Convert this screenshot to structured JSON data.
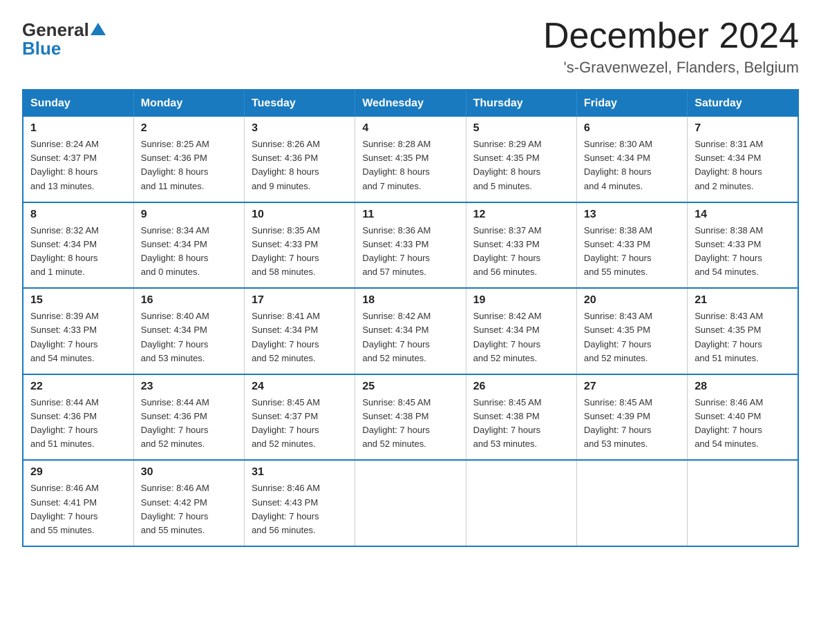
{
  "logo": {
    "part1": "General",
    "part2": "Blue"
  },
  "title": "December 2024",
  "subtitle": "'s-Gravenwezel, Flanders, Belgium",
  "calendar": {
    "headers": [
      "Sunday",
      "Monday",
      "Tuesday",
      "Wednesday",
      "Thursday",
      "Friday",
      "Saturday"
    ],
    "weeks": [
      [
        {
          "day": "1",
          "info": "Sunrise: 8:24 AM\nSunset: 4:37 PM\nDaylight: 8 hours\nand 13 minutes."
        },
        {
          "day": "2",
          "info": "Sunrise: 8:25 AM\nSunset: 4:36 PM\nDaylight: 8 hours\nand 11 minutes."
        },
        {
          "day": "3",
          "info": "Sunrise: 8:26 AM\nSunset: 4:36 PM\nDaylight: 8 hours\nand 9 minutes."
        },
        {
          "day": "4",
          "info": "Sunrise: 8:28 AM\nSunset: 4:35 PM\nDaylight: 8 hours\nand 7 minutes."
        },
        {
          "day": "5",
          "info": "Sunrise: 8:29 AM\nSunset: 4:35 PM\nDaylight: 8 hours\nand 5 minutes."
        },
        {
          "day": "6",
          "info": "Sunrise: 8:30 AM\nSunset: 4:34 PM\nDaylight: 8 hours\nand 4 minutes."
        },
        {
          "day": "7",
          "info": "Sunrise: 8:31 AM\nSunset: 4:34 PM\nDaylight: 8 hours\nand 2 minutes."
        }
      ],
      [
        {
          "day": "8",
          "info": "Sunrise: 8:32 AM\nSunset: 4:34 PM\nDaylight: 8 hours\nand 1 minute."
        },
        {
          "day": "9",
          "info": "Sunrise: 8:34 AM\nSunset: 4:34 PM\nDaylight: 8 hours\nand 0 minutes."
        },
        {
          "day": "10",
          "info": "Sunrise: 8:35 AM\nSunset: 4:33 PM\nDaylight: 7 hours\nand 58 minutes."
        },
        {
          "day": "11",
          "info": "Sunrise: 8:36 AM\nSunset: 4:33 PM\nDaylight: 7 hours\nand 57 minutes."
        },
        {
          "day": "12",
          "info": "Sunrise: 8:37 AM\nSunset: 4:33 PM\nDaylight: 7 hours\nand 56 minutes."
        },
        {
          "day": "13",
          "info": "Sunrise: 8:38 AM\nSunset: 4:33 PM\nDaylight: 7 hours\nand 55 minutes."
        },
        {
          "day": "14",
          "info": "Sunrise: 8:38 AM\nSunset: 4:33 PM\nDaylight: 7 hours\nand 54 minutes."
        }
      ],
      [
        {
          "day": "15",
          "info": "Sunrise: 8:39 AM\nSunset: 4:33 PM\nDaylight: 7 hours\nand 54 minutes."
        },
        {
          "day": "16",
          "info": "Sunrise: 8:40 AM\nSunset: 4:34 PM\nDaylight: 7 hours\nand 53 minutes."
        },
        {
          "day": "17",
          "info": "Sunrise: 8:41 AM\nSunset: 4:34 PM\nDaylight: 7 hours\nand 52 minutes."
        },
        {
          "day": "18",
          "info": "Sunrise: 8:42 AM\nSunset: 4:34 PM\nDaylight: 7 hours\nand 52 minutes."
        },
        {
          "day": "19",
          "info": "Sunrise: 8:42 AM\nSunset: 4:34 PM\nDaylight: 7 hours\nand 52 minutes."
        },
        {
          "day": "20",
          "info": "Sunrise: 8:43 AM\nSunset: 4:35 PM\nDaylight: 7 hours\nand 52 minutes."
        },
        {
          "day": "21",
          "info": "Sunrise: 8:43 AM\nSunset: 4:35 PM\nDaylight: 7 hours\nand 51 minutes."
        }
      ],
      [
        {
          "day": "22",
          "info": "Sunrise: 8:44 AM\nSunset: 4:36 PM\nDaylight: 7 hours\nand 51 minutes."
        },
        {
          "day": "23",
          "info": "Sunrise: 8:44 AM\nSunset: 4:36 PM\nDaylight: 7 hours\nand 52 minutes."
        },
        {
          "day": "24",
          "info": "Sunrise: 8:45 AM\nSunset: 4:37 PM\nDaylight: 7 hours\nand 52 minutes."
        },
        {
          "day": "25",
          "info": "Sunrise: 8:45 AM\nSunset: 4:38 PM\nDaylight: 7 hours\nand 52 minutes."
        },
        {
          "day": "26",
          "info": "Sunrise: 8:45 AM\nSunset: 4:38 PM\nDaylight: 7 hours\nand 53 minutes."
        },
        {
          "day": "27",
          "info": "Sunrise: 8:45 AM\nSunset: 4:39 PM\nDaylight: 7 hours\nand 53 minutes."
        },
        {
          "day": "28",
          "info": "Sunrise: 8:46 AM\nSunset: 4:40 PM\nDaylight: 7 hours\nand 54 minutes."
        }
      ],
      [
        {
          "day": "29",
          "info": "Sunrise: 8:46 AM\nSunset: 4:41 PM\nDaylight: 7 hours\nand 55 minutes."
        },
        {
          "day": "30",
          "info": "Sunrise: 8:46 AM\nSunset: 4:42 PM\nDaylight: 7 hours\nand 55 minutes."
        },
        {
          "day": "31",
          "info": "Sunrise: 8:46 AM\nSunset: 4:43 PM\nDaylight: 7 hours\nand 56 minutes."
        },
        {
          "day": "",
          "info": ""
        },
        {
          "day": "",
          "info": ""
        },
        {
          "day": "",
          "info": ""
        },
        {
          "day": "",
          "info": ""
        }
      ]
    ]
  }
}
